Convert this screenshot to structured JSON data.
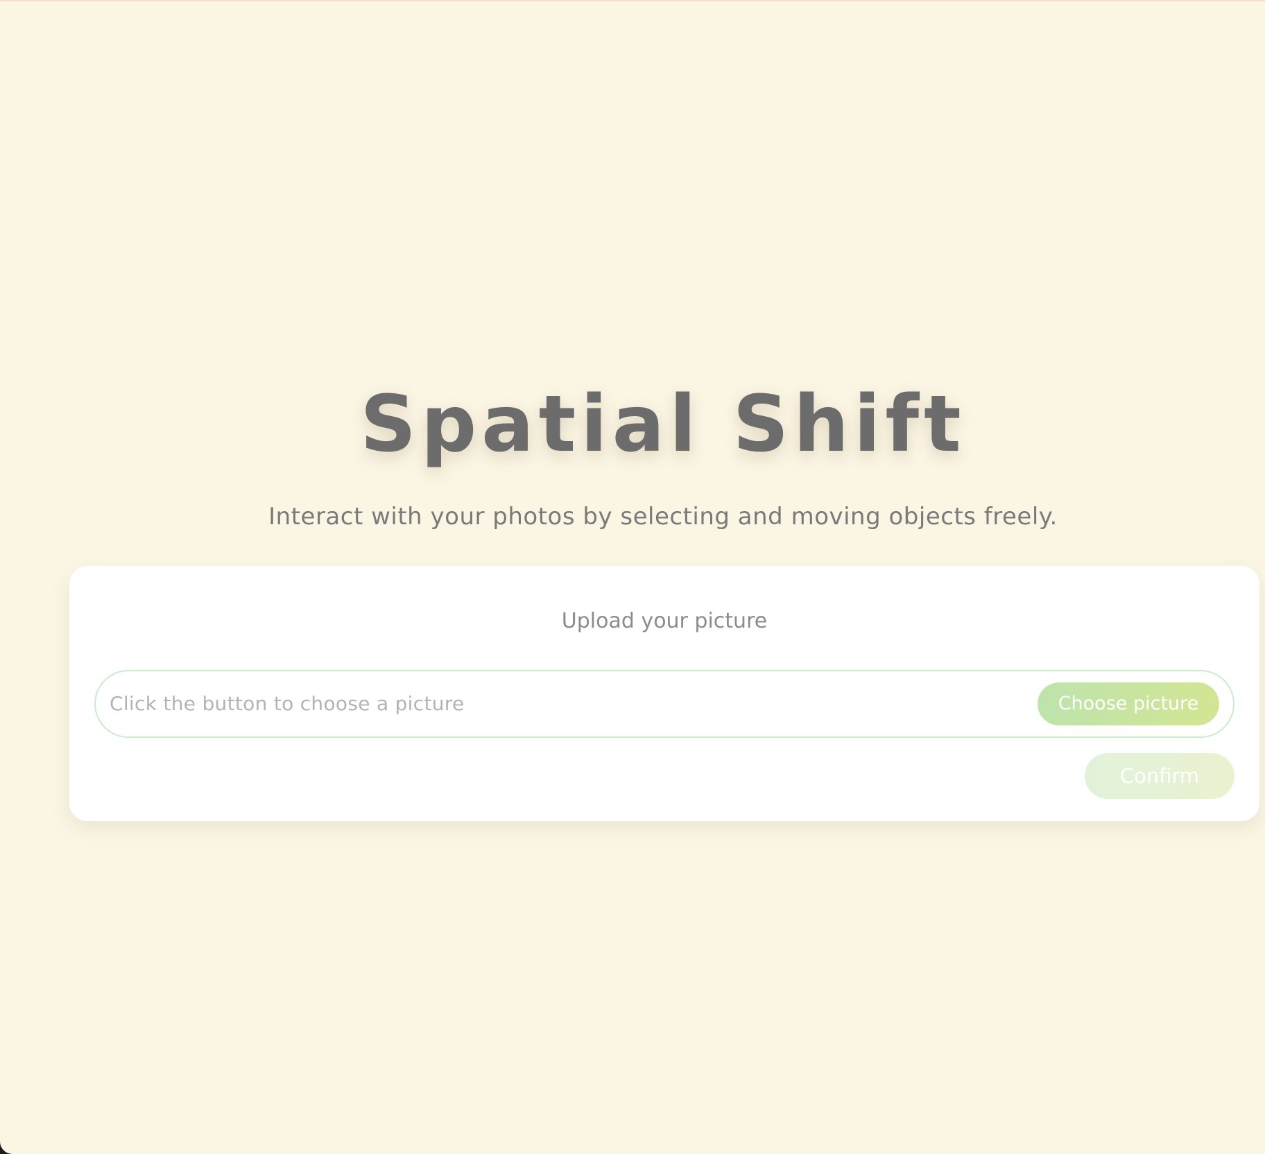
{
  "app": {
    "title": "Spatial Shift",
    "subtitle": "Interact with your photos by selecting and moving objects freely."
  },
  "upload": {
    "label": "Upload your picture",
    "placeholder": "Click the button to choose a picture",
    "choose_label": "Choose picture",
    "confirm_label": "Confirm"
  },
  "colors": {
    "background": "#fbf5e4",
    "title": "#6c6c6c",
    "accent_green": "#bde4ad",
    "accent_lime": "#d3e593"
  }
}
